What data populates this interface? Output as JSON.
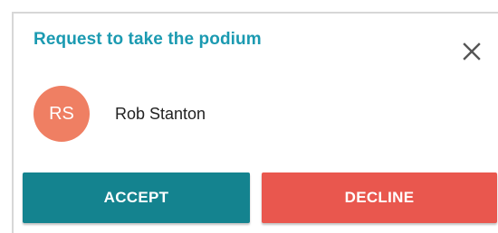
{
  "dialog": {
    "title": "Request to take the podium",
    "close_icon": "close-icon",
    "user": {
      "initials": "RS",
      "name": "Rob Stanton"
    },
    "accept_label": "ACCEPT",
    "decline_label": "DECLINE"
  },
  "colors": {
    "title": "#1b9ab1",
    "accept": "#14838f",
    "decline": "#e9574e",
    "avatar": "#ef7f63",
    "close": "#555555"
  }
}
